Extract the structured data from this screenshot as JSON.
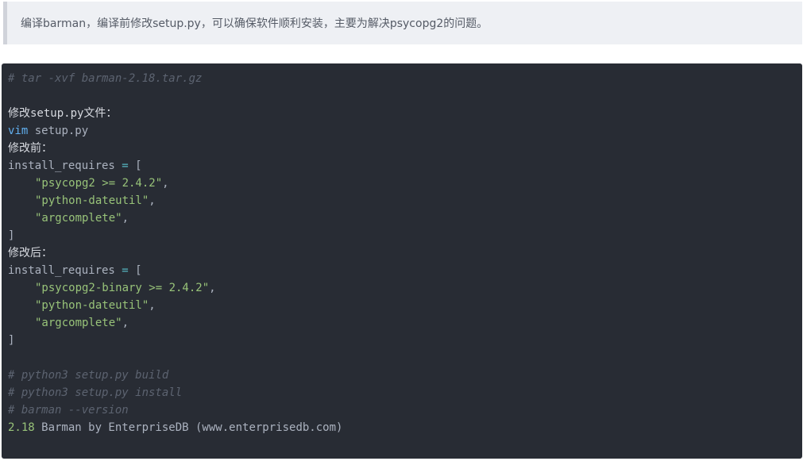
{
  "note": {
    "text": "编译barman，编译前修改setup.py，可以确保软件顺利安装，主要为解决psycopg2的问题。"
  },
  "code": {
    "lines": [
      {
        "type": "comment",
        "text": "# tar -xvf barman-2.18.tar.gz"
      },
      {
        "type": "blank",
        "text": ""
      },
      {
        "type": "text",
        "text": "修改setup.py文件："
      },
      {
        "type": "cmd",
        "keyword": "vim",
        "rest": " setup.py"
      },
      {
        "type": "text",
        "text": "修改前："
      },
      {
        "type": "assign",
        "name": "install_requires",
        "op": "=",
        "bracket": "["
      },
      {
        "type": "string",
        "value": "\"psycopg2 >= 2.4.2\"",
        "suffix": ","
      },
      {
        "type": "string",
        "value": "\"python-dateutil\"",
        "suffix": ","
      },
      {
        "type": "string",
        "value": "\"argcomplete\"",
        "suffix": ","
      },
      {
        "type": "text",
        "text": "]"
      },
      {
        "type": "text",
        "text": "修改后："
      },
      {
        "type": "assign",
        "name": "install_requires",
        "op": "=",
        "bracket": "["
      },
      {
        "type": "string",
        "value": "\"psycopg2-binary >= 2.4.2\"",
        "suffix": ","
      },
      {
        "type": "string",
        "value": "\"python-dateutil\"",
        "suffix": ","
      },
      {
        "type": "string",
        "value": "\"argcomplete\"",
        "suffix": ","
      },
      {
        "type": "text",
        "text": "]"
      },
      {
        "type": "blank",
        "text": ""
      },
      {
        "type": "comment",
        "text": "# python3 setup.py build"
      },
      {
        "type": "comment",
        "text": "# python3 setup.py install"
      },
      {
        "type": "comment",
        "text": "# barman --version"
      },
      {
        "type": "version",
        "number": "2.18",
        "rest": " Barman by EnterpriseDB (www.enterprisedb.com)"
      }
    ]
  },
  "colors": {
    "code_background": "#282c34",
    "comment": "#5c6370",
    "keyword": "#61afef",
    "string": "#98c379",
    "number": "#d19a66",
    "note_background": "#eef0f4"
  }
}
